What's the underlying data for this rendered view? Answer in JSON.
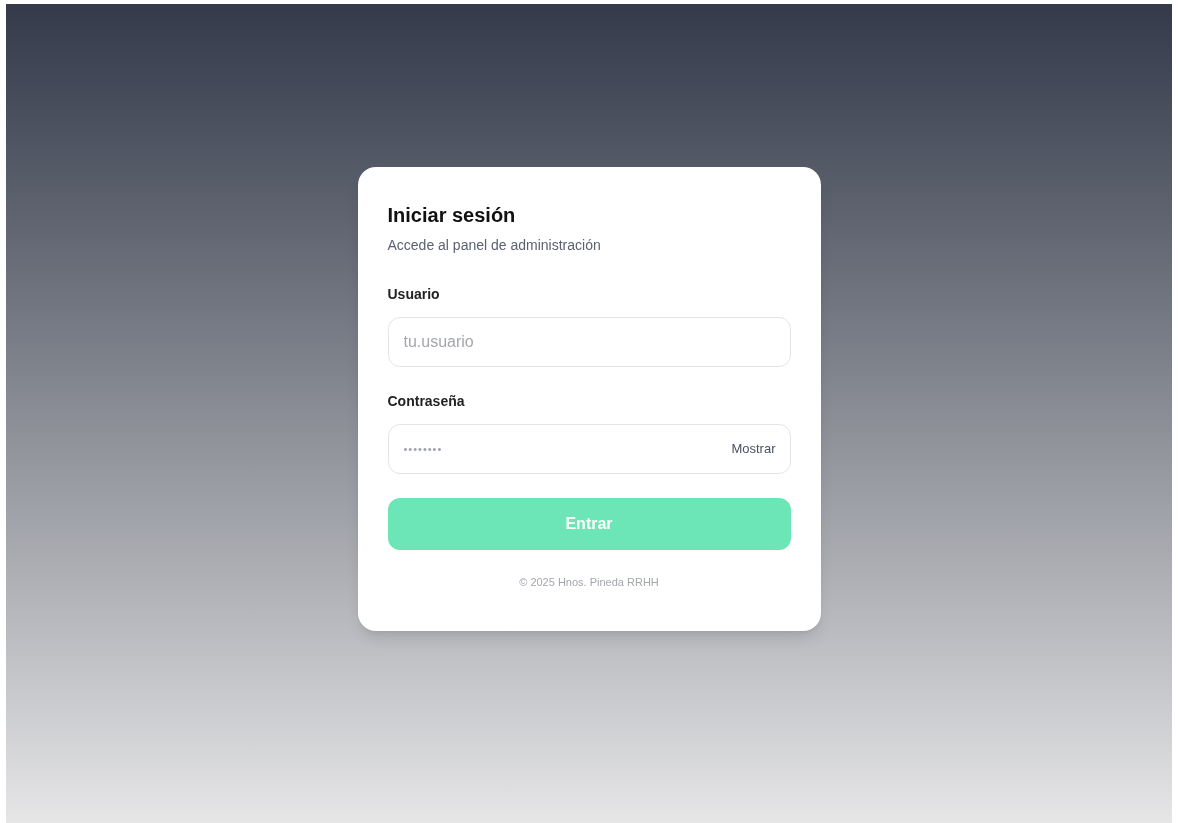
{
  "card": {
    "title": "Iniciar sesión",
    "subtitle": "Accede al panel de administración"
  },
  "fields": [
    {
      "kind": "text",
      "label": "Usuario",
      "placeholder": "tu.usuario"
    },
    {
      "kind": "password",
      "label": "Contraseña",
      "value": "••••••••",
      "toggle": "Mostrar"
    }
  ],
  "submit": {
    "label": "Entrar",
    "disabled": true
  },
  "footer": "© 2025 Hnos. Pineda RRHH"
}
